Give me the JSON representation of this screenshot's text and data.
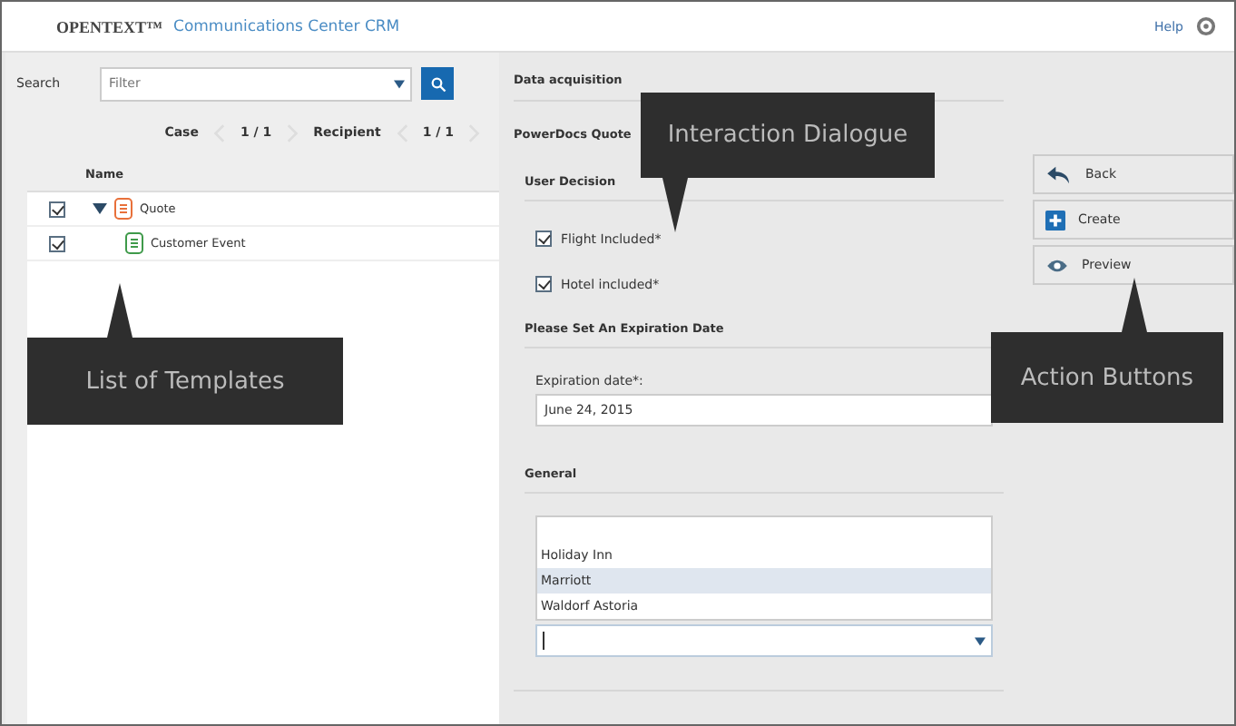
{
  "header": {
    "brand": "OPENTEXT™",
    "product": "Communications Center CRM",
    "help": "Help"
  },
  "left": {
    "search_label": "Search",
    "search": {
      "placeholder": "Filter"
    },
    "pager": [
      {
        "label": "Case",
        "value": "1 / 1"
      },
      {
        "label": "Recipient",
        "value": "1 / 1"
      }
    ],
    "columns": [
      "Name"
    ],
    "tree": [
      {
        "name": "Quote",
        "checked": true,
        "expanded": true,
        "kind": "quote",
        "children": [
          {
            "name": "Customer Event",
            "checked": true,
            "kind": "event"
          }
        ]
      }
    ]
  },
  "form": {
    "title": "Data acquisition",
    "subtitle": "PowerDocs Quote",
    "decision_title": "User Decision",
    "checks": [
      {
        "label": "Flight Included*",
        "checked": true
      },
      {
        "label": "Hotel included*",
        "checked": true
      }
    ],
    "date_title": "Please Set An Expiration Date",
    "date_label": "Expiration date*:",
    "date_value": "June 24, 2015",
    "general_title": "General",
    "options": [
      {
        "label": "Holiday Inn",
        "selected": false
      },
      {
        "label": "Marriott",
        "selected": true
      },
      {
        "label": "Waldorf Astoria",
        "selected": false
      }
    ]
  },
  "actions": [
    {
      "label": "Back",
      "kind": "back"
    },
    {
      "label": "Create",
      "kind": "create"
    },
    {
      "label": "Preview",
      "kind": "preview"
    }
  ],
  "callouts": [
    {
      "text": "Interaction Dialogue",
      "kind": "down"
    },
    {
      "text": "List of Templates",
      "kind": "up"
    },
    {
      "text": "Action Buttons",
      "kind": "up"
    }
  ]
}
